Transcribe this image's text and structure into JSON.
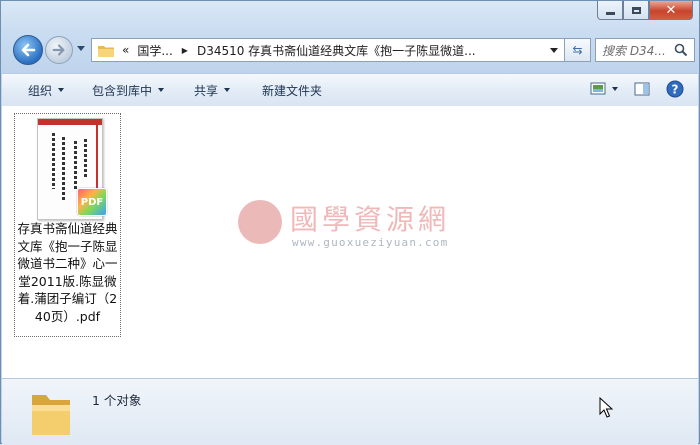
{
  "address": {
    "overflow": "«",
    "crumb_parent": "国学...",
    "crumb_current": "D34510 存真书斋仙道经典文库《抱一子陈显微道..."
  },
  "search": {
    "placeholder": "搜索 D34..."
  },
  "toolbar": {
    "organize": "组织",
    "include_in_library": "包含到库中",
    "share": "共享",
    "new_folder": "新建文件夹"
  },
  "file": {
    "name": "存真书斋仙道经典文库《抱一子陈显微道书二种》心一堂2011版.陈显微着.蒲团子编订（240页）.pdf",
    "badge": "PDF"
  },
  "watermark": {
    "title": "國學資源網",
    "url": "www.guoxueziyuan.com"
  },
  "status": {
    "count": "1 个对象"
  },
  "colors": {
    "close_button": "#c7452d",
    "accent": "#2a6fc2",
    "pdf_red": "#c4322e"
  }
}
